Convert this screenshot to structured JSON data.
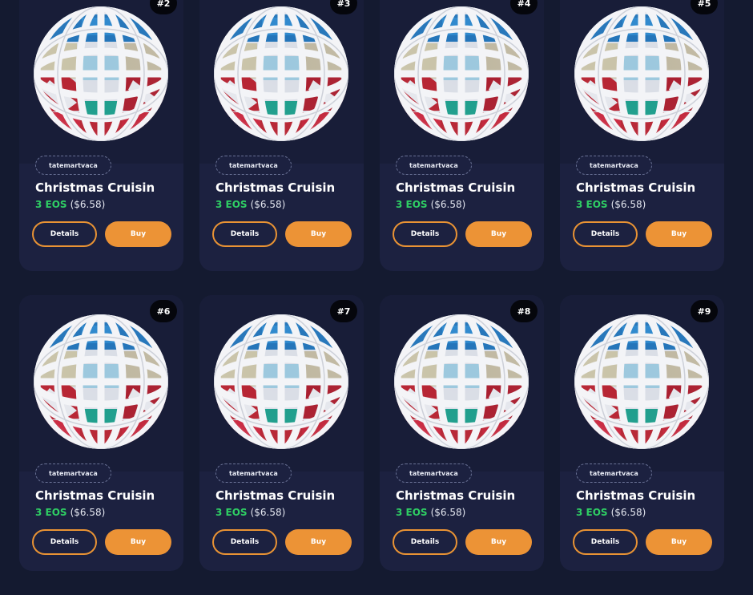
{
  "cards": [
    {
      "badge": "#2",
      "creator": "tatemartvaca",
      "title": "Christmas Cruisin",
      "price_eos": "3 EOS",
      "price_usd": "($6.58)",
      "details_label": "Details",
      "buy_label": "Buy"
    },
    {
      "badge": "#3",
      "creator": "tatemartvaca",
      "title": "Christmas Cruisin",
      "price_eos": "3 EOS",
      "price_usd": "($6.58)",
      "details_label": "Details",
      "buy_label": "Buy"
    },
    {
      "badge": "#4",
      "creator": "tatemartvaca",
      "title": "Christmas Cruisin",
      "price_eos": "3 EOS",
      "price_usd": "($6.58)",
      "details_label": "Details",
      "buy_label": "Buy"
    },
    {
      "badge": "#5",
      "creator": "tatemartvaca",
      "title": "Christmas Cruisin",
      "price_eos": "3 EOS",
      "price_usd": "($6.58)",
      "details_label": "Details",
      "buy_label": "Buy"
    },
    {
      "badge": "#6",
      "creator": "tatemartvaca",
      "title": "Christmas Cruisin",
      "price_eos": "3 EOS",
      "price_usd": "($6.58)",
      "details_label": "Details",
      "buy_label": "Buy"
    },
    {
      "badge": "#7",
      "creator": "tatemartvaca",
      "title": "Christmas Cruisin",
      "price_eos": "3 EOS",
      "price_usd": "($6.58)",
      "details_label": "Details",
      "buy_label": "Buy"
    },
    {
      "badge": "#8",
      "creator": "tatemartvaca",
      "title": "Christmas Cruisin",
      "price_eos": "3 EOS",
      "price_usd": "($6.58)",
      "details_label": "Details",
      "buy_label": "Buy"
    },
    {
      "badge": "#9",
      "creator": "tatemartvaca",
      "title": "Christmas Cruisin",
      "price_eos": "3 EOS",
      "price_usd": "($6.58)",
      "details_label": "Details",
      "buy_label": "Buy"
    }
  ],
  "colors": {
    "page_bg": "#141a30",
    "card_bg": "#1c2140",
    "accent_orange": "#ec9336",
    "price_green": "#2fcf64"
  }
}
